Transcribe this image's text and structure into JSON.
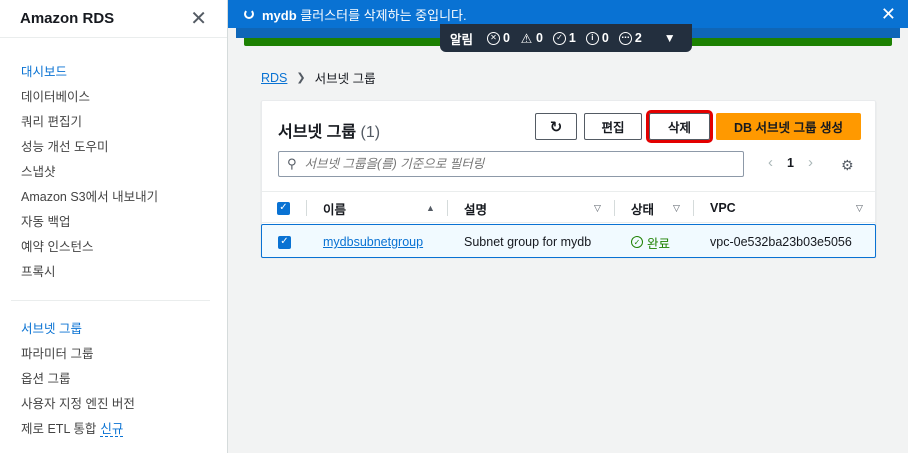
{
  "sidebar": {
    "title": "Amazon RDS",
    "items": [
      {
        "label": "대시보드",
        "active": true
      },
      {
        "label": "데이터베이스"
      },
      {
        "label": "쿼리 편집기"
      },
      {
        "label": "성능 개선 도우미"
      },
      {
        "label": "스냅샷"
      },
      {
        "label": "Amazon S3에서 내보내기"
      },
      {
        "label": "자동 백업"
      },
      {
        "label": "예약 인스턴스"
      },
      {
        "label": "프록시"
      }
    ],
    "items2": [
      {
        "label": "서브넷 그룹",
        "active": true
      },
      {
        "label": "파라미터 그룹"
      },
      {
        "label": "옵션 그룹"
      },
      {
        "label": "사용자 지정 엔진 버전"
      },
      {
        "label": "제로 ETL 통합",
        "badge": "신규"
      }
    ]
  },
  "flash": {
    "db_name": "mydb",
    "message": " 클러스터를 삭제하는 중입니다."
  },
  "notifications": {
    "label": "알림",
    "errors": "0",
    "warnings": "0",
    "success": "1",
    "info": "0",
    "in_progress": "2"
  },
  "breadcrumb": {
    "root": "RDS",
    "current": "서브넷 그룹"
  },
  "card": {
    "title": "서브넷 그룹",
    "count": "(1)",
    "edit_label": "편집",
    "delete_label": "삭제",
    "create_label": "DB 서브넷 그룹 생성",
    "search_placeholder": "서브넷 그룹을(를) 기준으로 필터링",
    "page": "1"
  },
  "table": {
    "headers": {
      "name": "이름",
      "description": "설명",
      "status": "상태",
      "vpc": "VPC"
    },
    "rows": [
      {
        "name": "mydbsubnetgroup",
        "description": "Subnet group for mydb",
        "status": "완료",
        "vpc": "vpc-0e532ba23b03e5056"
      }
    ]
  },
  "colors": {
    "accent": "#0972d3",
    "primary_button": "#ff9900",
    "success": "#1d8102",
    "highlight": "#e30000"
  }
}
